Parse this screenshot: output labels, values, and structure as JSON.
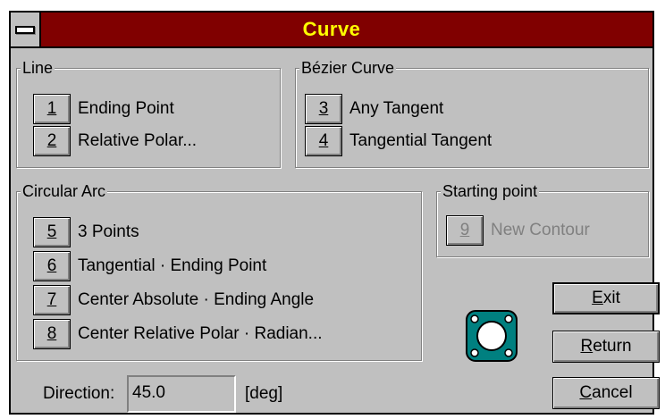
{
  "window": {
    "title": "Curve"
  },
  "groups": {
    "line": {
      "label": "Line",
      "items": [
        {
          "num": "1",
          "label": "Ending Point"
        },
        {
          "num": "2",
          "label": "Relative Polar..."
        }
      ]
    },
    "bezier": {
      "label": "Bézier Curve",
      "items": [
        {
          "num": "3",
          "label": "Any Tangent"
        },
        {
          "num": "4",
          "label": "Tangential Tangent"
        }
      ]
    },
    "arc": {
      "label": "Circular Arc",
      "items": [
        {
          "num": "5",
          "label": "3 Points"
        },
        {
          "num": "6",
          "label": "Tangential · Ending Point"
        },
        {
          "num": "7",
          "label": "Center Absolute · Ending Angle"
        },
        {
          "num": "8",
          "label": "Center Relative Polar · Radian..."
        }
      ]
    },
    "start": {
      "label": "Starting point",
      "items": [
        {
          "num": "9",
          "label": "New Contour",
          "disabled": true
        }
      ]
    }
  },
  "buttons": {
    "exit": {
      "pre": "",
      "ul": "E",
      "post": "xit"
    },
    "return": {
      "pre": "",
      "ul": "R",
      "post": "eturn"
    },
    "cancel": {
      "pre": "",
      "ul": "C",
      "post": "ancel"
    }
  },
  "direction": {
    "label": "Direction:",
    "value": "45.0",
    "unit": "[deg]"
  },
  "icons": {
    "contour": "contour-icon"
  },
  "colors": {
    "title_bg": "#800000",
    "title_fg": "#ffff00",
    "face": "#c0c0c0",
    "icon_fill": "#008080"
  }
}
